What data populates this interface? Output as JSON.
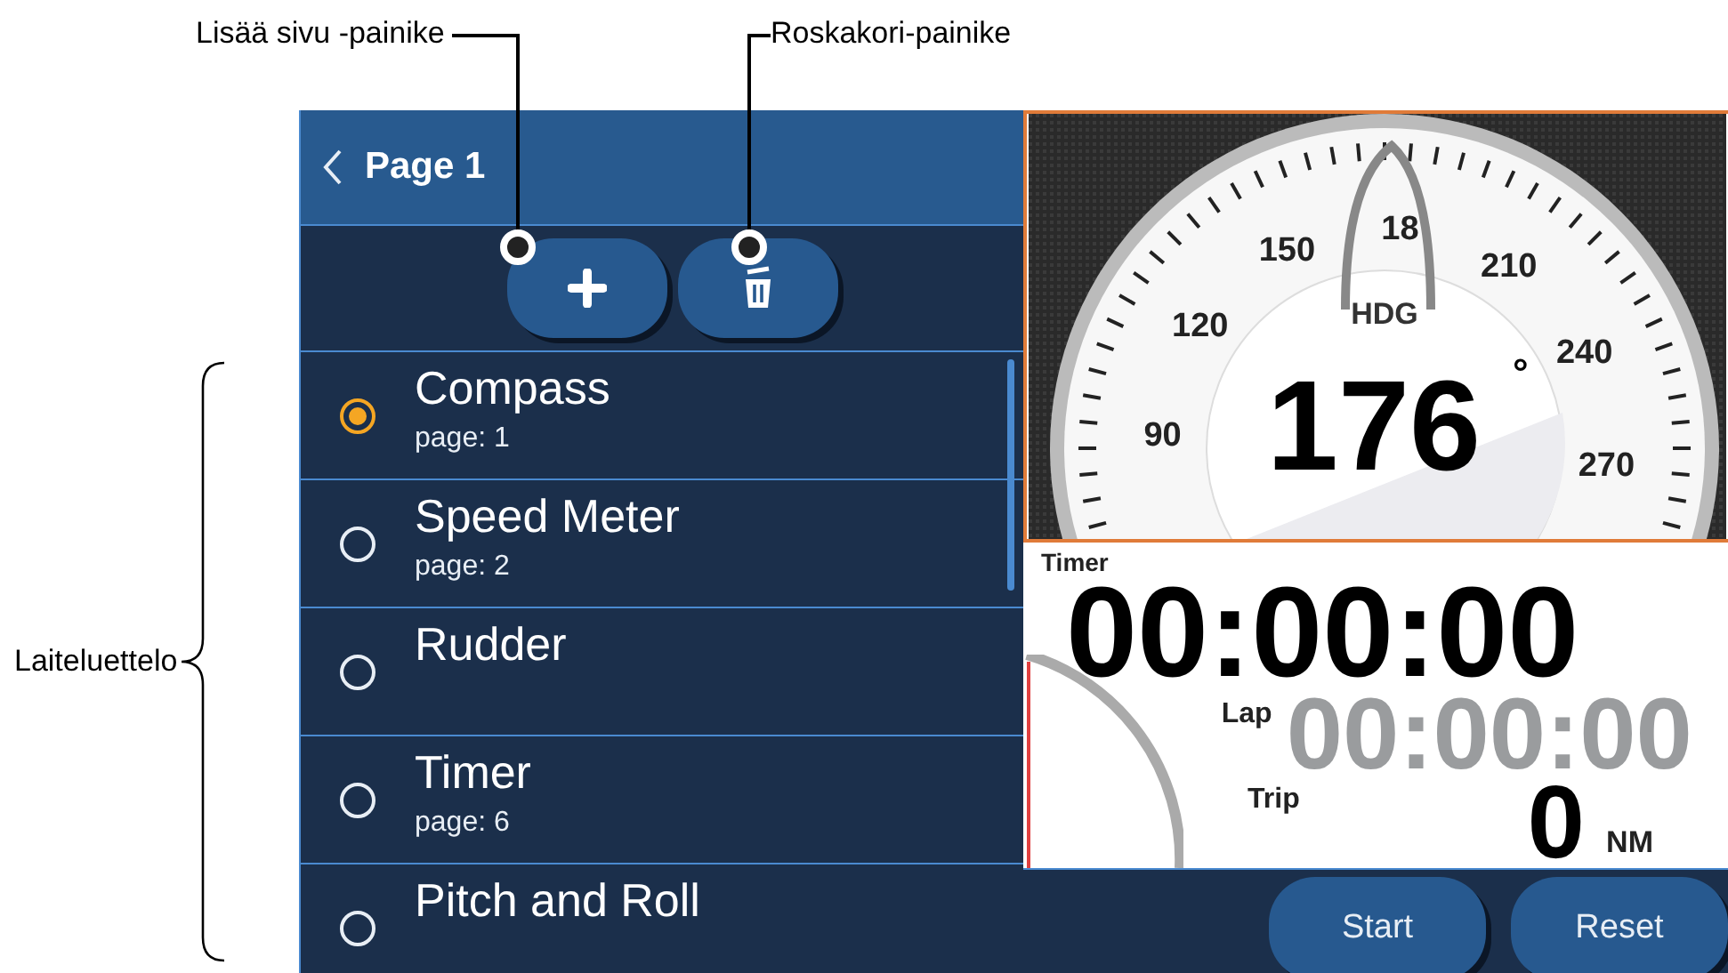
{
  "annotations": [
    {
      "kind": "callout",
      "text": "Lisää sivu -painike"
    },
    {
      "kind": "callout",
      "text": "Roskakori-painike"
    },
    {
      "kind": "brace",
      "text": "Laiteluettelo"
    }
  ],
  "page_list": {
    "title": "Page 1",
    "items": [
      {
        "name": "Compass",
        "page": "page: 1",
        "selected": true
      },
      {
        "name": "Speed Meter",
        "page": "page: 2",
        "selected": false
      },
      {
        "name": "Rudder",
        "selected": false
      },
      {
        "name": "Timer",
        "page": "page: 6",
        "selected": false
      },
      {
        "name": "Pitch and Roll",
        "selected": false
      }
    ]
  },
  "compass": {
    "scale": [
      "90",
      "120",
      "150",
      "18",
      "210",
      "240",
      "270"
    ],
    "label": "HDG",
    "heading": "176",
    "degree": "°"
  },
  "timer": {
    "title": "Timer",
    "time": "00:00:00",
    "lap_label": "Lap",
    "lap_time": "00:00:00",
    "trip_label": "Trip",
    "trip_value": "0",
    "trip_unit": "NM",
    "buttons": [
      "Start",
      "Reset"
    ]
  }
}
